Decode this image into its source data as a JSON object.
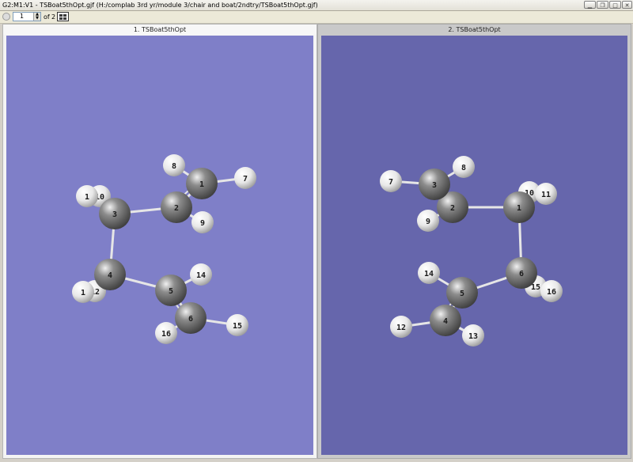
{
  "window": {
    "title": "G2:M1:V1 - TSBoat5thOpt.gjf (H:/complab 3rd yr/module 3/chair and boat/2ndtry/TSBoat5thOpt.gjf)",
    "buttons": [
      "minimize",
      "restore",
      "maximize",
      "close"
    ]
  },
  "toolbar": {
    "current_page": "1",
    "of_label": "of",
    "total_pages": "2"
  },
  "colors": {
    "panel1_background": "#7f7fc8",
    "panel2_background": "#6666ac",
    "carbon": "#8c8c8c",
    "hydrogen": "#e8e8e8",
    "bond": "#e6e6e6"
  },
  "panels": [
    {
      "header": "1. TSBoat5thOpt",
      "atoms": [
        {
          "label": "1",
          "element": "C"
        },
        {
          "label": "2",
          "element": "C"
        },
        {
          "label": "3",
          "element": "C"
        },
        {
          "label": "4",
          "element": "C"
        },
        {
          "label": "5",
          "element": "C"
        },
        {
          "label": "6",
          "element": "C"
        },
        {
          "label": "7",
          "element": "H"
        },
        {
          "label": "8",
          "element": "H"
        },
        {
          "label": "9",
          "element": "H"
        },
        {
          "label": "10",
          "element": "H"
        },
        {
          "label": "1",
          "element": "H"
        },
        {
          "label": "12",
          "element": "H"
        },
        {
          "label": "1",
          "element": "H"
        },
        {
          "label": "14",
          "element": "H"
        },
        {
          "label": "15",
          "element": "H"
        },
        {
          "label": "16",
          "element": "H"
        }
      ]
    },
    {
      "header": "2. TSBoat5thOpt",
      "atoms": [
        {
          "label": "1",
          "element": "C"
        },
        {
          "label": "2",
          "element": "C"
        },
        {
          "label": "3",
          "element": "C"
        },
        {
          "label": "4",
          "element": "C"
        },
        {
          "label": "5",
          "element": "C"
        },
        {
          "label": "6",
          "element": "C"
        },
        {
          "label": "7",
          "element": "H"
        },
        {
          "label": "8",
          "element": "H"
        },
        {
          "label": "9",
          "element": "H"
        },
        {
          "label": "10",
          "element": "H"
        },
        {
          "label": "11",
          "element": "H"
        },
        {
          "label": "12",
          "element": "H"
        },
        {
          "label": "13",
          "element": "H"
        },
        {
          "label": "14",
          "element": "H"
        },
        {
          "label": "15",
          "element": "H"
        },
        {
          "label": "16",
          "element": "H"
        }
      ]
    }
  ]
}
